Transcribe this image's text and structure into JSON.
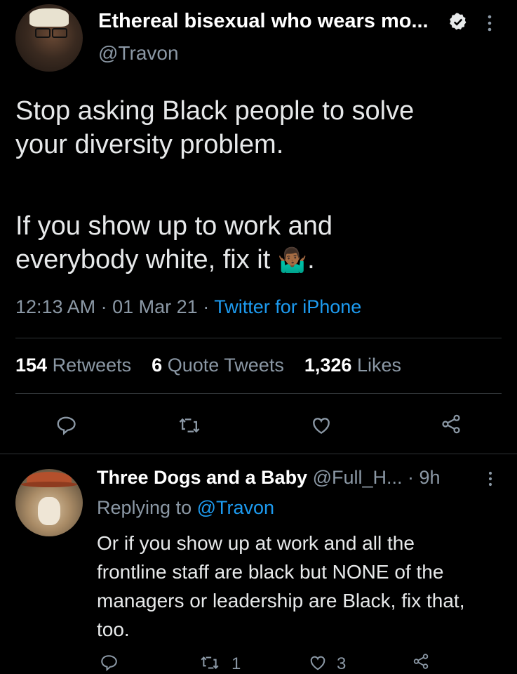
{
  "main_tweet": {
    "display_name": "Ethereal bisexual who wears mo...",
    "handle": "@Travon",
    "text_line1": "Stop asking Black people to solve",
    "text_line2": "your diversity problem.",
    "text_line3": "If you show up to work and",
    "text_line4": "everybody white, fix it",
    "emoji": "🤷🏾‍♂️",
    "text_end": ".",
    "time": "12:13 AM",
    "date": "01 Mar 21",
    "sep": "·",
    "source": "Twitter for iPhone",
    "stats": {
      "retweets_count": "154",
      "retweets_label": "Retweets",
      "quotes_count": "6",
      "quotes_label": "Quote Tweets",
      "likes_count": "1,326",
      "likes_label": "Likes"
    }
  },
  "reply": {
    "display_name": "Three Dogs and a Baby",
    "handle": "@Full_H...",
    "time": "· 9h",
    "replying_prefix": "Replying to",
    "replying_to": "@Travon",
    "line1": "Or if you show up at work and all the",
    "line2": "frontline staff are black but NONE of the",
    "line3": "managers or leadership are Black, fix that,",
    "line4": "too.",
    "retweet_count": "1",
    "like_count": "3"
  },
  "icons": {
    "verified": "verified-badge-icon",
    "more": "more-vertical-icon",
    "reply": "reply-icon",
    "retweet": "retweet-icon",
    "like": "heart-icon",
    "share": "share-icon"
  },
  "colors": {
    "background": "#000000",
    "link": "#1d9bf0",
    "muted": "#8b98a5",
    "divider": "#2f3336"
  }
}
